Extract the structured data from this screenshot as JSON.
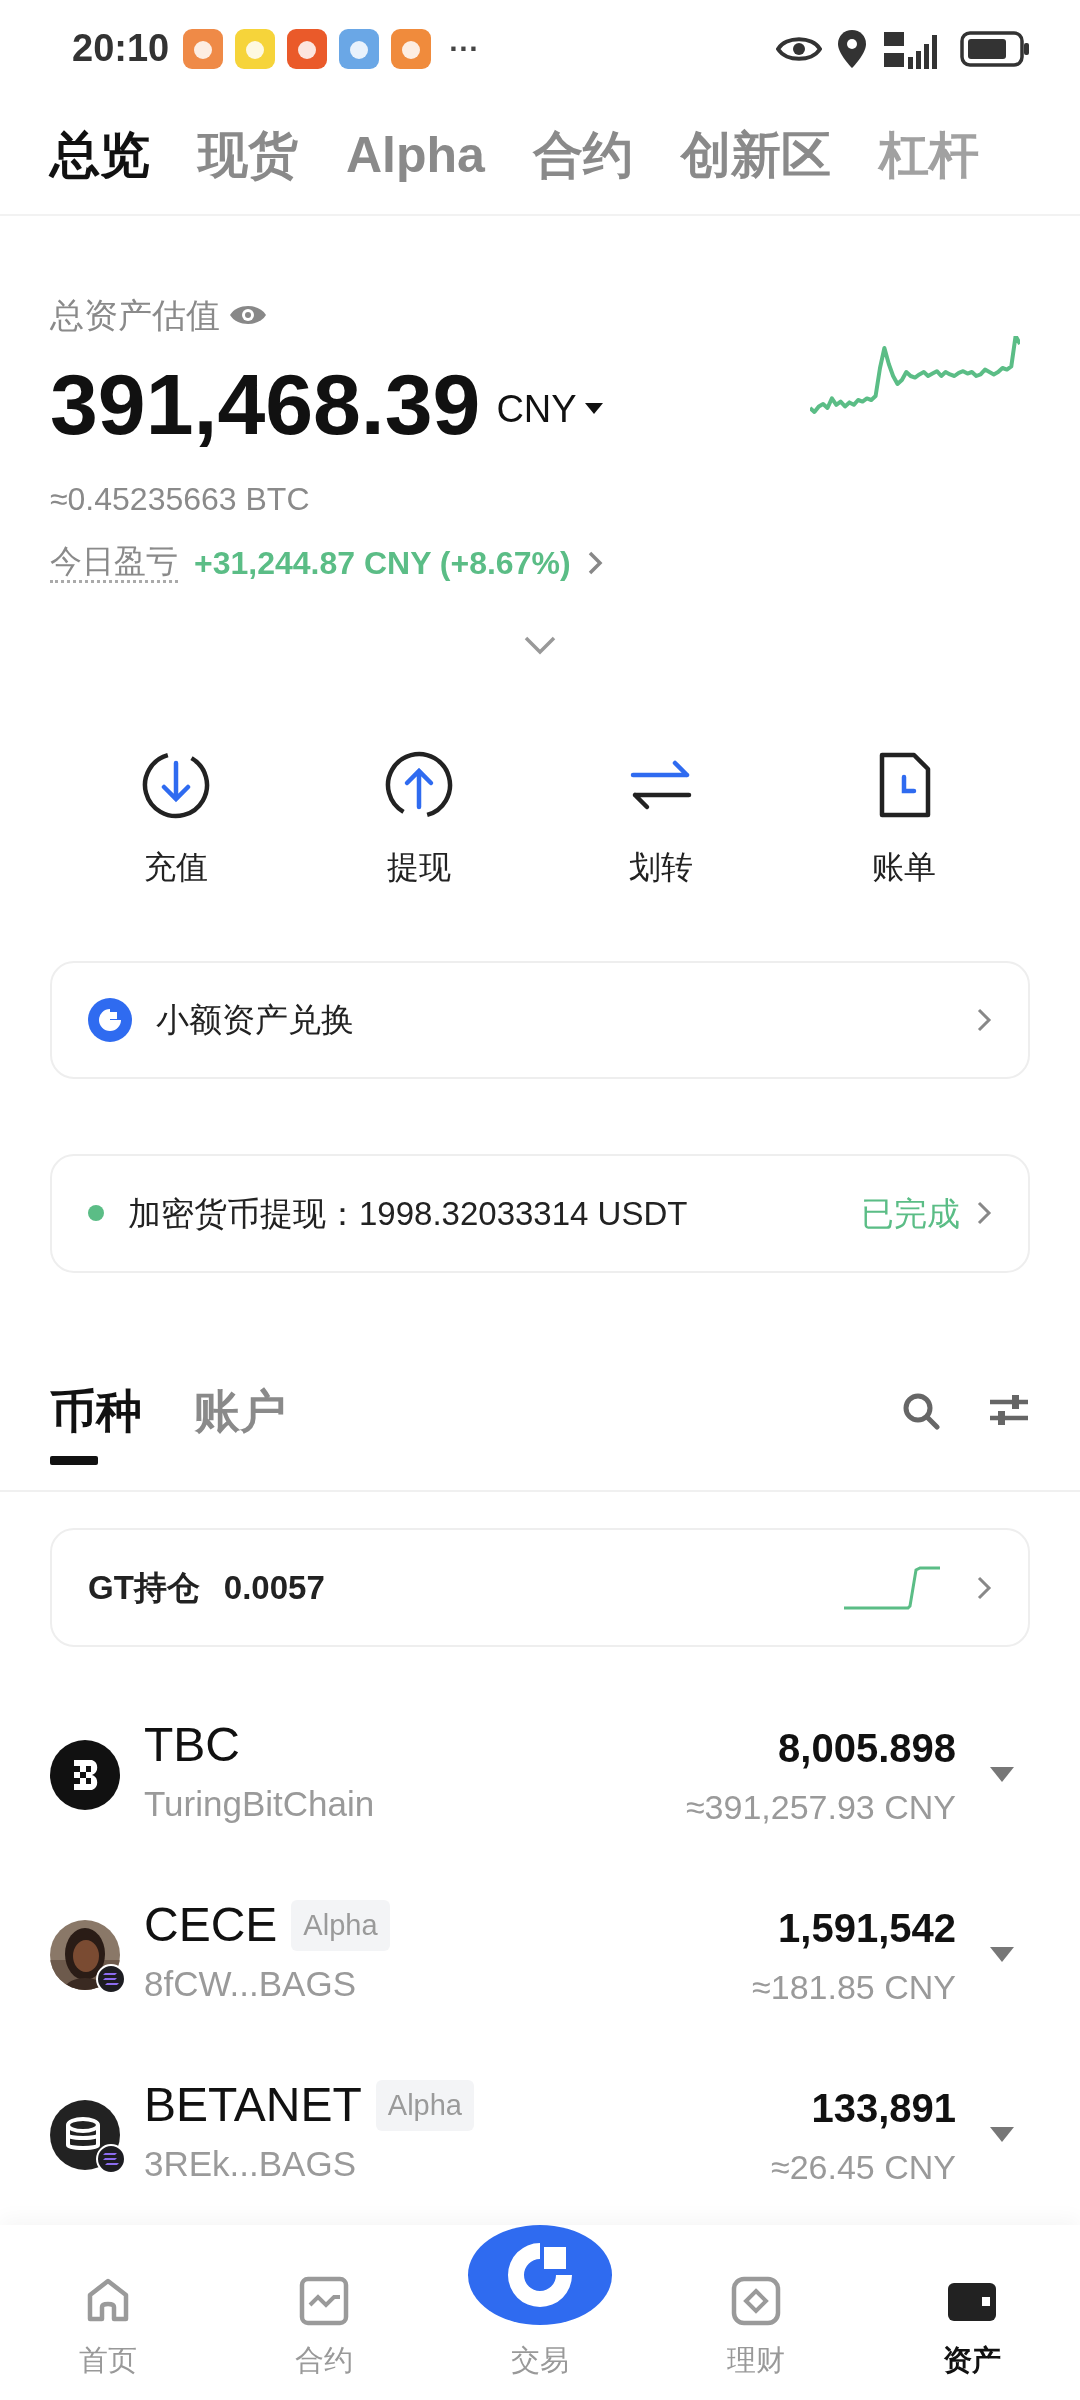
{
  "status_bar": {
    "time": "20:10",
    "more": "···"
  },
  "top_tabs": [
    {
      "label": "总览",
      "selected": true
    },
    {
      "label": "现货",
      "selected": false
    },
    {
      "label": "Alpha",
      "selected": false
    },
    {
      "label": "合约",
      "selected": false
    },
    {
      "label": "创新区",
      "selected": false
    },
    {
      "label": "杠杆",
      "selected": false
    }
  ],
  "summary": {
    "label": "总资产估值",
    "value": "391,468.39",
    "currency": "CNY",
    "btc": "≈0.45235663 BTC",
    "pnl_label": "今日盈亏",
    "pnl": "+31,244.87 CNY (+8.67%)"
  },
  "actions": [
    {
      "label": "充值",
      "kind": "deposit"
    },
    {
      "label": "提现",
      "kind": "withdraw"
    },
    {
      "label": "划转",
      "kind": "transfer"
    },
    {
      "label": "账单",
      "kind": "bill"
    }
  ],
  "convert_card": {
    "label": "小额资产兑换"
  },
  "withdraw_notice": {
    "label": "加密货币提现：",
    "amount": "1998.32033314 USDT",
    "status": "已完成"
  },
  "asset_tabs": [
    {
      "label": "币种",
      "selected": true
    },
    {
      "label": "账户",
      "selected": false
    }
  ],
  "gt_card": {
    "label": "GT持仓",
    "value": "0.0057"
  },
  "tokens": [
    {
      "symbol": "TBC",
      "name": "TuringBitChain",
      "amount": "8,005.898",
      "value": "≈391,257.93 CNY",
      "kind": "tbc",
      "chain_badge": false
    },
    {
      "symbol": "CECE",
      "tag": "Alpha",
      "name": "8fCW...BAGS",
      "amount": "1,591,542",
      "value": "≈181.85 CNY",
      "kind": "picture",
      "chain_badge": true
    },
    {
      "symbol": "BETANET",
      "tag": "Alpha",
      "name": "3REk...BAGS",
      "amount": "133,891",
      "value": "≈26.45 CNY",
      "kind": "coins",
      "chain_badge": true
    }
  ],
  "bottom_nav": [
    {
      "label": "首页",
      "kind": "home",
      "selected": false
    },
    {
      "label": "合约",
      "kind": "futures",
      "selected": false
    },
    {
      "label": "交易",
      "kind": "trade",
      "selected": false
    },
    {
      "label": "理财",
      "kind": "earn",
      "selected": false
    },
    {
      "label": "资产",
      "kind": "wallet",
      "selected": true
    }
  ]
}
